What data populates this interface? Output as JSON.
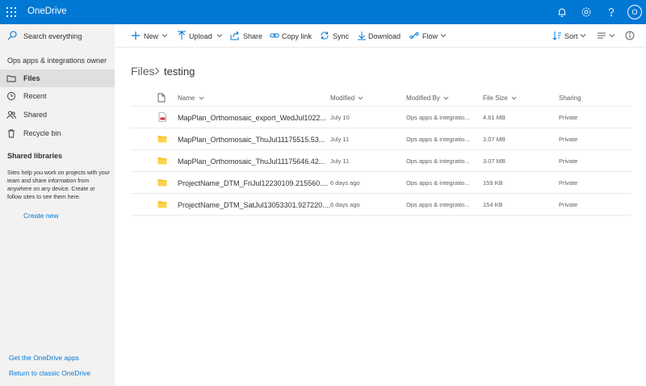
{
  "header": {
    "title": "OneDrive",
    "avatar_initial": "O",
    "brand_color": "#0078d4",
    "icons": [
      "app-launcher-icon",
      "bell-icon",
      "gear-icon",
      "help-icon"
    ]
  },
  "search": {
    "placeholder": "Search everything"
  },
  "nav": {
    "owner": "Ops apps & integrations owner",
    "items": [
      {
        "label": "Files",
        "icon": "folder-icon",
        "active": true
      },
      {
        "label": "Recent",
        "icon": "clock-icon"
      },
      {
        "label": "Shared",
        "icon": "people-icon"
      },
      {
        "label": "Recycle bin",
        "icon": "trash-icon"
      }
    ],
    "shared_libraries_heading": "Shared libraries",
    "shared_libraries_text": "Sites help you work on projects with your team and share information from anywhere on any device. Create or follow sites to see them here.",
    "create_new": "Create new",
    "get_apps": "Get the OneDrive apps",
    "classic": "Return to classic OneDrive"
  },
  "commands": {
    "new": "New",
    "upload": "Upload",
    "share": "Share",
    "copy_link": "Copy link",
    "sync": "Sync",
    "download": "Download",
    "flow": "Flow",
    "sort": "Sort"
  },
  "breadcrumb": {
    "root": "Files",
    "current": "testing"
  },
  "table": {
    "columns": {
      "name": "Name",
      "modified": "Modified",
      "modified_by": "Modified By",
      "file_size": "File Size",
      "sharing": "Sharing"
    },
    "rows": [
      {
        "type": "pdf",
        "name": "MapPlan_Orthomosaic_export_WedJul1022...",
        "modified": "July 10",
        "modified_by": "Ops apps & integratio...",
        "size": "4.61 MB",
        "sharing": "Private"
      },
      {
        "type": "folder",
        "name": "MapPlan_Orthomosaic_ThuJul11175515.53...",
        "modified": "July 11",
        "modified_by": "Ops apps & integratio...",
        "size": "3.07 MB",
        "sharing": "Private"
      },
      {
        "type": "folder",
        "name": "MapPlan_Orthomosaic_ThuJul11175646.42...",
        "modified": "July 11",
        "modified_by": "Ops apps & integratio...",
        "size": "3.07 MB",
        "sharing": "Private"
      },
      {
        "type": "folder",
        "name": "ProjectName_DTM_FriJul12230109.215560....",
        "modified": "6 days ago",
        "modified_by": "Ops apps & integratio...",
        "size": "159 KB",
        "sharing": "Private"
      },
      {
        "type": "folder",
        "name": "ProjectName_DTM_SatJul13053301.927220....",
        "modified": "6 days ago",
        "modified_by": "Ops apps & integratio...",
        "size": "154 KB",
        "sharing": "Private"
      }
    ]
  }
}
